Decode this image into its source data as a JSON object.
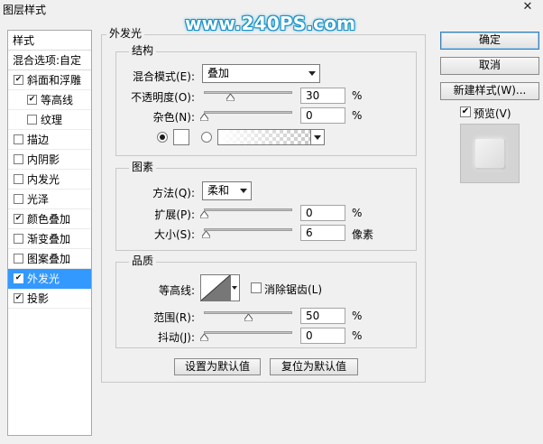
{
  "window": {
    "title": "图层样式",
    "close": "✕"
  },
  "watermark": "www.240PS.com",
  "styles_panel": {
    "header": "样式",
    "blend_options": "混合选项:自定",
    "items": [
      {
        "label": "斜面和浮雕",
        "checked": true,
        "indent": false,
        "selected": false
      },
      {
        "label": "等高线",
        "checked": true,
        "indent": true,
        "selected": false
      },
      {
        "label": "纹理",
        "checked": false,
        "indent": true,
        "selected": false
      },
      {
        "label": "描边",
        "checked": false,
        "indent": false,
        "selected": false
      },
      {
        "label": "内阴影",
        "checked": false,
        "indent": false,
        "selected": false
      },
      {
        "label": "内发光",
        "checked": false,
        "indent": false,
        "selected": false
      },
      {
        "label": "光泽",
        "checked": false,
        "indent": false,
        "selected": false
      },
      {
        "label": "颜色叠加",
        "checked": true,
        "indent": false,
        "selected": false
      },
      {
        "label": "渐变叠加",
        "checked": false,
        "indent": false,
        "selected": false
      },
      {
        "label": "图案叠加",
        "checked": false,
        "indent": false,
        "selected": false
      },
      {
        "label": "外发光",
        "checked": true,
        "indent": false,
        "selected": true
      },
      {
        "label": "投影",
        "checked": true,
        "indent": false,
        "selected": false
      }
    ]
  },
  "outer_glow": {
    "title": "外发光",
    "structure": {
      "title": "结构",
      "blend_mode_label": "混合模式(E):",
      "blend_mode_value": "叠加",
      "opacity_label": "不透明度(O):",
      "opacity_value": "30",
      "opacity_unit": "%",
      "opacity_level": 0.3,
      "noise_label": "杂色(N):",
      "noise_value": "0",
      "noise_unit": "%",
      "noise_level": 0.0,
      "color_radio_selected": true,
      "gradient_radio_selected": false
    },
    "elements": {
      "title": "图素",
      "technique_label": "方法(Q):",
      "technique_value": "柔和",
      "spread_label": "扩展(P):",
      "spread_value": "0",
      "spread_unit": "%",
      "spread_level": 0.0,
      "size_label": "大小(S):",
      "size_value": "6",
      "size_unit": "像素",
      "size_level": 0.024
    },
    "quality": {
      "title": "品质",
      "contour_label": "等高线:",
      "anti_alias_label": "消除锯齿(L)",
      "anti_alias_checked": false,
      "range_label": "范围(R):",
      "range_value": "50",
      "range_unit": "%",
      "range_level": 0.5,
      "jitter_label": "抖动(J):",
      "jitter_value": "0",
      "jitter_unit": "%",
      "jitter_level": 0.0
    },
    "set_default": "设置为默认值",
    "reset_default": "复位为默认值"
  },
  "actions": {
    "ok": "确定",
    "cancel": "取消",
    "new_style": "新建样式(W)...",
    "preview_label": "预览(V)",
    "preview_checked": true
  }
}
